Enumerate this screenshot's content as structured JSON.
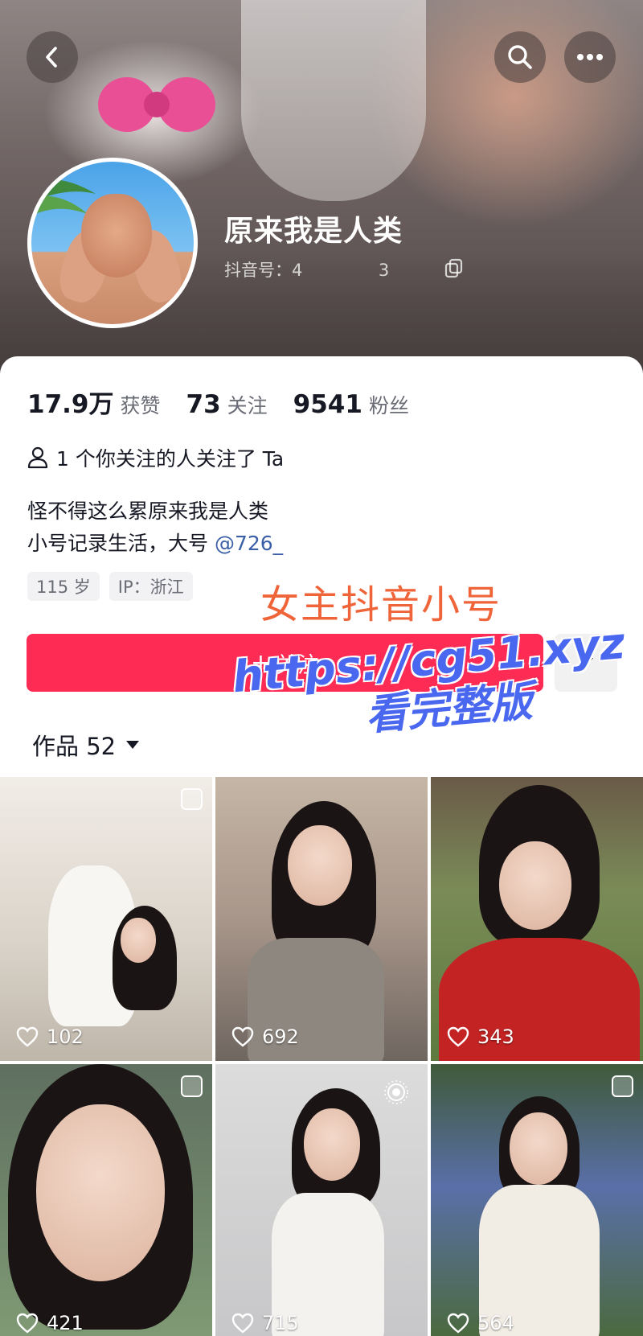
{
  "header": {
    "nickname": "原来我是人类",
    "douyin_id": "抖音号：4         3",
    "back_icon": "chevron-left-icon",
    "search_icon": "search-icon",
    "more_icon": "more-dots-icon"
  },
  "stats": [
    {
      "num": "17.9万",
      "label": "获赞"
    },
    {
      "num": "73",
      "label": "关注"
    },
    {
      "num": "9541",
      "label": "粉丝"
    }
  ],
  "mutual_follow": "1 个你关注的人关注了 Ta",
  "bio": {
    "line1": "怪不得这么累原来我是人类",
    "line2_prefix": "小号记录生活，大号 ",
    "line2_mention": "@726_"
  },
  "tags": [
    "115 岁",
    "IP：浙江"
  ],
  "overlay_title": "女主抖音小号",
  "follow_button": {
    "plus": "+",
    "label": "关注"
  },
  "watermark": {
    "line1": "https://cg51.xyz",
    "line2": "看完整版"
  },
  "works_tab": {
    "label": "作品 52"
  },
  "colors": {
    "accent": "#fe2c55",
    "mention": "#3a5fa6",
    "overlay": "#f0643a",
    "watermark": "#4a67f0"
  },
  "videos": [
    {
      "likes": "102"
    },
    {
      "likes": "692"
    },
    {
      "likes": "343"
    },
    {
      "likes": "421"
    },
    {
      "likes": "715"
    },
    {
      "likes": "564"
    }
  ]
}
